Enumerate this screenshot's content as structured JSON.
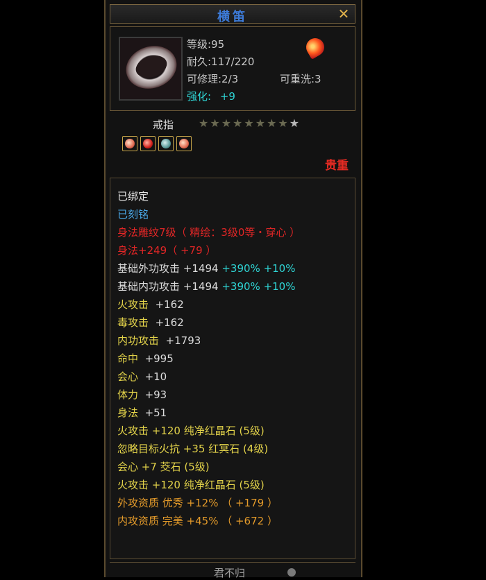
{
  "window": {
    "title": "横笛",
    "close_symbol": "✕"
  },
  "item": {
    "level_label": "等级:95",
    "durability_label": "耐久:117/220",
    "repair_label": "可修理:2/3",
    "rewash_label": "可重洗:3",
    "enhance_label": "强化:",
    "enhance_value": "+9",
    "type_label": "戒指",
    "stars": {
      "filled": 8,
      "total": 9
    },
    "rarity": "贵重",
    "gems": [
      "fire-gem-icon",
      "red-gem-icon",
      "teal-gem-icon",
      "fire-gem-icon"
    ]
  },
  "attributes": {
    "bound": "已绑定",
    "engraved": "已刻铭",
    "carving": "身法雕纹7级（ 精绘：3级0等・穿心 ）",
    "agility_bonus": "身法+249（ +79 ）",
    "ext_attack": {
      "label": "基础外功攻击",
      "value": "+1494",
      "pct1": "+390%",
      "pct2": "+10%"
    },
    "int_attack": {
      "label": "基础内功攻击",
      "value": "+1494",
      "pct1": "+390%",
      "pct2": "+10%"
    },
    "plain": [
      {
        "label": "火攻击",
        "value": "+162"
      },
      {
        "label": "毒攻击",
        "value": "+162"
      },
      {
        "label": "内功攻击",
        "value": "+1793"
      },
      {
        "label": "命中",
        "value": "+995"
      },
      {
        "label": "会心",
        "value": "+10"
      },
      {
        "label": "体力",
        "value": "+93"
      },
      {
        "label": "身法",
        "value": "+51"
      }
    ],
    "gem_lines": [
      "火攻击 +120 纯净红晶石 (5级)",
      "忽略目标火抗 +35 红冥石 (4级)",
      "会心 +7 茭石 (5级)",
      "火攻击 +120 纯净红晶石 (5级)"
    ],
    "quality": [
      "外攻资质  优秀 +12% （ +179 ）",
      "内攻资质  完美 +45% （ +672 ）"
    ]
  },
  "footer": {
    "name": "君不归"
  },
  "colors": {
    "title": "#3d7bd8",
    "red": "#e12626",
    "yellow": "#e3d34a",
    "orange": "#e39a2a",
    "cyan": "#2fd6d6",
    "blue": "#4aa8e8"
  }
}
